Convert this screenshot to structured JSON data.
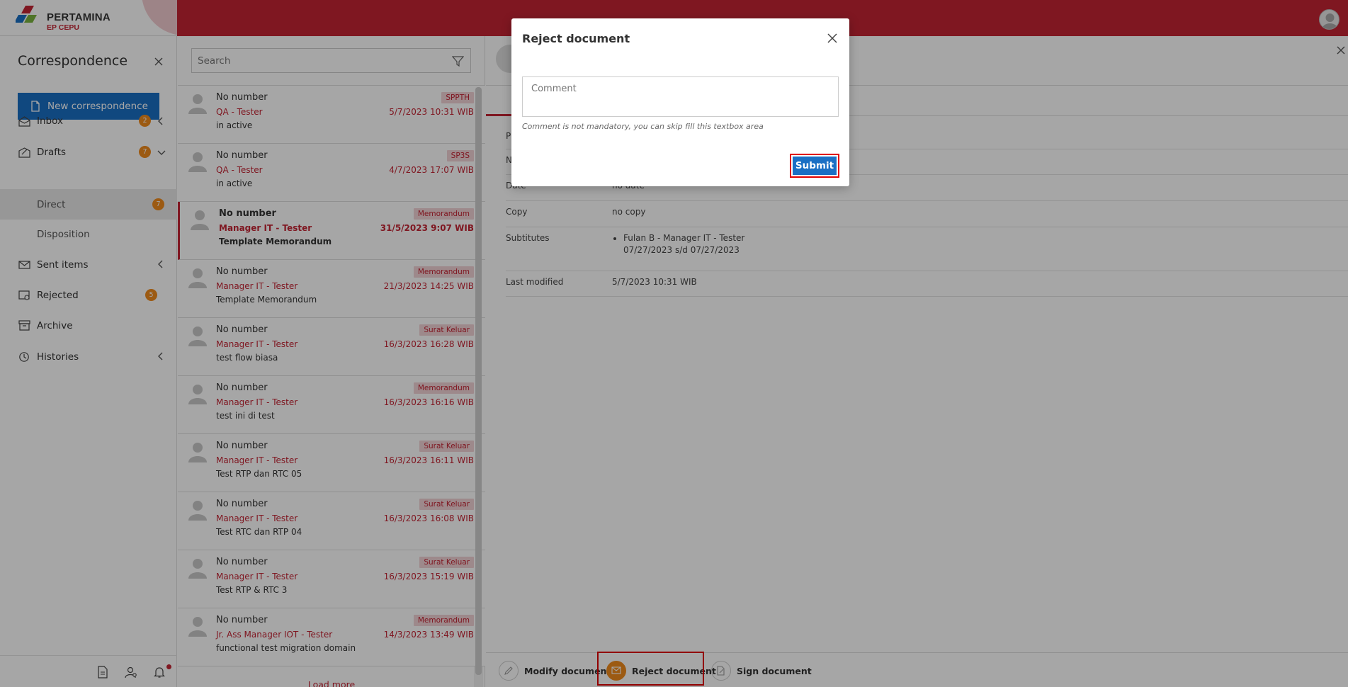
{
  "brand": {
    "name": "PERTAMINA",
    "sub": "EP CEPU"
  },
  "sidebar": {
    "title": "Correspondence",
    "new_button": "New correspondence",
    "items": [
      {
        "label": "Inbox",
        "badge": "2",
        "chevron": "left"
      },
      {
        "label": "Drafts",
        "badge": "7",
        "chevron": "down"
      },
      {
        "label": "Direct",
        "badge": "7",
        "sub": true,
        "active": true
      },
      {
        "label": "Disposition",
        "sub": true
      },
      {
        "label": "Sent items",
        "chevron": "left"
      },
      {
        "label": "Rejected",
        "badge": "5"
      },
      {
        "label": "Archive"
      },
      {
        "label": "Histories",
        "chevron": "left"
      }
    ],
    "bottom_icons": [
      "document-icon",
      "user-settings-icon",
      "bell-icon"
    ]
  },
  "list": {
    "search_placeholder": "Search",
    "rows": [
      {
        "number": "No number",
        "sender": "QA - Tester",
        "subject": "in active",
        "tag": "SPPTH",
        "date": "5/7/2023 10:31 WIB"
      },
      {
        "number": "No number",
        "sender": "QA - Tester",
        "subject": "in active",
        "tag": "SP3S",
        "date": "4/7/2023 17:07 WIB"
      },
      {
        "number": "No number",
        "sender": "Manager IT - Tester",
        "subject": "Template Memorandum",
        "tag": "Memorandum",
        "date": "31/5/2023 9:07 WIB",
        "selected": true
      },
      {
        "number": "No number",
        "sender": "Manager IT - Tester",
        "subject": "Template Memorandum",
        "tag": "Memorandum",
        "date": "21/3/2023 14:25 WIB"
      },
      {
        "number": "No number",
        "sender": "Manager IT - Tester",
        "subject": "test flow biasa",
        "tag": "Surat Keluar",
        "date": "16/3/2023 16:28 WIB"
      },
      {
        "number": "No number",
        "sender": "Manager IT - Tester",
        "subject": "test ini di test",
        "tag": "Memorandum",
        "date": "16/3/2023 16:16 WIB"
      },
      {
        "number": "No number",
        "sender": "Manager IT - Tester",
        "subject": "Test RTP dan RTC 05",
        "tag": "Surat Keluar",
        "date": "16/3/2023 16:11 WIB"
      },
      {
        "number": "No number",
        "sender": "Manager IT - Tester",
        "subject": "Test RTC dan RTP 04",
        "tag": "Surat Keluar",
        "date": "16/3/2023 16:08 WIB"
      },
      {
        "number": "No number",
        "sender": "Manager IT - Tester",
        "subject": "Test RTP & RTC 3",
        "tag": "Surat Keluar",
        "date": "16/3/2023 15:19 WIB"
      },
      {
        "number": "No number",
        "sender": "Jr. Ass Manager IOT - Tester",
        "subject": "functional test migration domain",
        "tag": "Memorandum",
        "date": "14/3/2023 13:49 WIB"
      }
    ],
    "load_more": "Load more"
  },
  "detail": {
    "fields": [
      {
        "label": "P",
        "value": ""
      },
      {
        "label": "N",
        "value": ""
      },
      {
        "label": "Date",
        "value": "no date"
      },
      {
        "label": "Copy",
        "value": "no copy"
      },
      {
        "label": "Subtitutes",
        "list": [
          "Fulan B - Manager IT - Tester"
        ],
        "range": "07/27/2023 s/d 07/27/2023"
      },
      {
        "label": "Last modified",
        "value": "5/7/2023 10:31 WIB"
      }
    ],
    "actions": {
      "modify": "Modify document",
      "reject": "Reject document",
      "sign": "Sign document"
    }
  },
  "modal": {
    "title": "Reject document",
    "comment_placeholder": "Comment",
    "hint": "Comment is not mandatory, you can skip fill this textbox area",
    "submit": "Submit"
  },
  "colors": {
    "brand_red": "#c42434",
    "primary_blue": "#1a6fc4",
    "badge_orange": "#f08a1c",
    "highlight": "#e00000"
  }
}
